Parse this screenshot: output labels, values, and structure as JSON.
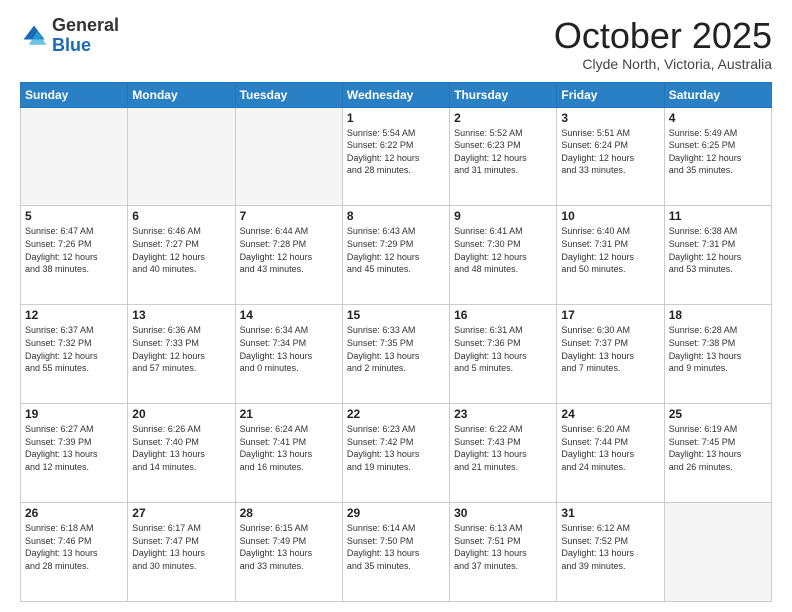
{
  "header": {
    "logo_general": "General",
    "logo_blue": "Blue",
    "month_title": "October 2025",
    "location": "Clyde North, Victoria, Australia"
  },
  "days_of_week": [
    "Sunday",
    "Monday",
    "Tuesday",
    "Wednesday",
    "Thursday",
    "Friday",
    "Saturday"
  ],
  "weeks": [
    [
      {
        "day": "",
        "info": ""
      },
      {
        "day": "",
        "info": ""
      },
      {
        "day": "",
        "info": ""
      },
      {
        "day": "1",
        "info": "Sunrise: 5:54 AM\nSunset: 6:22 PM\nDaylight: 12 hours\nand 28 minutes."
      },
      {
        "day": "2",
        "info": "Sunrise: 5:52 AM\nSunset: 6:23 PM\nDaylight: 12 hours\nand 31 minutes."
      },
      {
        "day": "3",
        "info": "Sunrise: 5:51 AM\nSunset: 6:24 PM\nDaylight: 12 hours\nand 33 minutes."
      },
      {
        "day": "4",
        "info": "Sunrise: 5:49 AM\nSunset: 6:25 PM\nDaylight: 12 hours\nand 35 minutes."
      }
    ],
    [
      {
        "day": "5",
        "info": "Sunrise: 6:47 AM\nSunset: 7:26 PM\nDaylight: 12 hours\nand 38 minutes."
      },
      {
        "day": "6",
        "info": "Sunrise: 6:46 AM\nSunset: 7:27 PM\nDaylight: 12 hours\nand 40 minutes."
      },
      {
        "day": "7",
        "info": "Sunrise: 6:44 AM\nSunset: 7:28 PM\nDaylight: 12 hours\nand 43 minutes."
      },
      {
        "day": "8",
        "info": "Sunrise: 6:43 AM\nSunset: 7:29 PM\nDaylight: 12 hours\nand 45 minutes."
      },
      {
        "day": "9",
        "info": "Sunrise: 6:41 AM\nSunset: 7:30 PM\nDaylight: 12 hours\nand 48 minutes."
      },
      {
        "day": "10",
        "info": "Sunrise: 6:40 AM\nSunset: 7:31 PM\nDaylight: 12 hours\nand 50 minutes."
      },
      {
        "day": "11",
        "info": "Sunrise: 6:38 AM\nSunset: 7:31 PM\nDaylight: 12 hours\nand 53 minutes."
      }
    ],
    [
      {
        "day": "12",
        "info": "Sunrise: 6:37 AM\nSunset: 7:32 PM\nDaylight: 12 hours\nand 55 minutes."
      },
      {
        "day": "13",
        "info": "Sunrise: 6:36 AM\nSunset: 7:33 PM\nDaylight: 12 hours\nand 57 minutes."
      },
      {
        "day": "14",
        "info": "Sunrise: 6:34 AM\nSunset: 7:34 PM\nDaylight: 13 hours\nand 0 minutes."
      },
      {
        "day": "15",
        "info": "Sunrise: 6:33 AM\nSunset: 7:35 PM\nDaylight: 13 hours\nand 2 minutes."
      },
      {
        "day": "16",
        "info": "Sunrise: 6:31 AM\nSunset: 7:36 PM\nDaylight: 13 hours\nand 5 minutes."
      },
      {
        "day": "17",
        "info": "Sunrise: 6:30 AM\nSunset: 7:37 PM\nDaylight: 13 hours\nand 7 minutes."
      },
      {
        "day": "18",
        "info": "Sunrise: 6:28 AM\nSunset: 7:38 PM\nDaylight: 13 hours\nand 9 minutes."
      }
    ],
    [
      {
        "day": "19",
        "info": "Sunrise: 6:27 AM\nSunset: 7:39 PM\nDaylight: 13 hours\nand 12 minutes."
      },
      {
        "day": "20",
        "info": "Sunrise: 6:26 AM\nSunset: 7:40 PM\nDaylight: 13 hours\nand 14 minutes."
      },
      {
        "day": "21",
        "info": "Sunrise: 6:24 AM\nSunset: 7:41 PM\nDaylight: 13 hours\nand 16 minutes."
      },
      {
        "day": "22",
        "info": "Sunrise: 6:23 AM\nSunset: 7:42 PM\nDaylight: 13 hours\nand 19 minutes."
      },
      {
        "day": "23",
        "info": "Sunrise: 6:22 AM\nSunset: 7:43 PM\nDaylight: 13 hours\nand 21 minutes."
      },
      {
        "day": "24",
        "info": "Sunrise: 6:20 AM\nSunset: 7:44 PM\nDaylight: 13 hours\nand 24 minutes."
      },
      {
        "day": "25",
        "info": "Sunrise: 6:19 AM\nSunset: 7:45 PM\nDaylight: 13 hours\nand 26 minutes."
      }
    ],
    [
      {
        "day": "26",
        "info": "Sunrise: 6:18 AM\nSunset: 7:46 PM\nDaylight: 13 hours\nand 28 minutes."
      },
      {
        "day": "27",
        "info": "Sunrise: 6:17 AM\nSunset: 7:47 PM\nDaylight: 13 hours\nand 30 minutes."
      },
      {
        "day": "28",
        "info": "Sunrise: 6:15 AM\nSunset: 7:49 PM\nDaylight: 13 hours\nand 33 minutes."
      },
      {
        "day": "29",
        "info": "Sunrise: 6:14 AM\nSunset: 7:50 PM\nDaylight: 13 hours\nand 35 minutes."
      },
      {
        "day": "30",
        "info": "Sunrise: 6:13 AM\nSunset: 7:51 PM\nDaylight: 13 hours\nand 37 minutes."
      },
      {
        "day": "31",
        "info": "Sunrise: 6:12 AM\nSunset: 7:52 PM\nDaylight: 13 hours\nand 39 minutes."
      },
      {
        "day": "",
        "info": ""
      }
    ]
  ]
}
